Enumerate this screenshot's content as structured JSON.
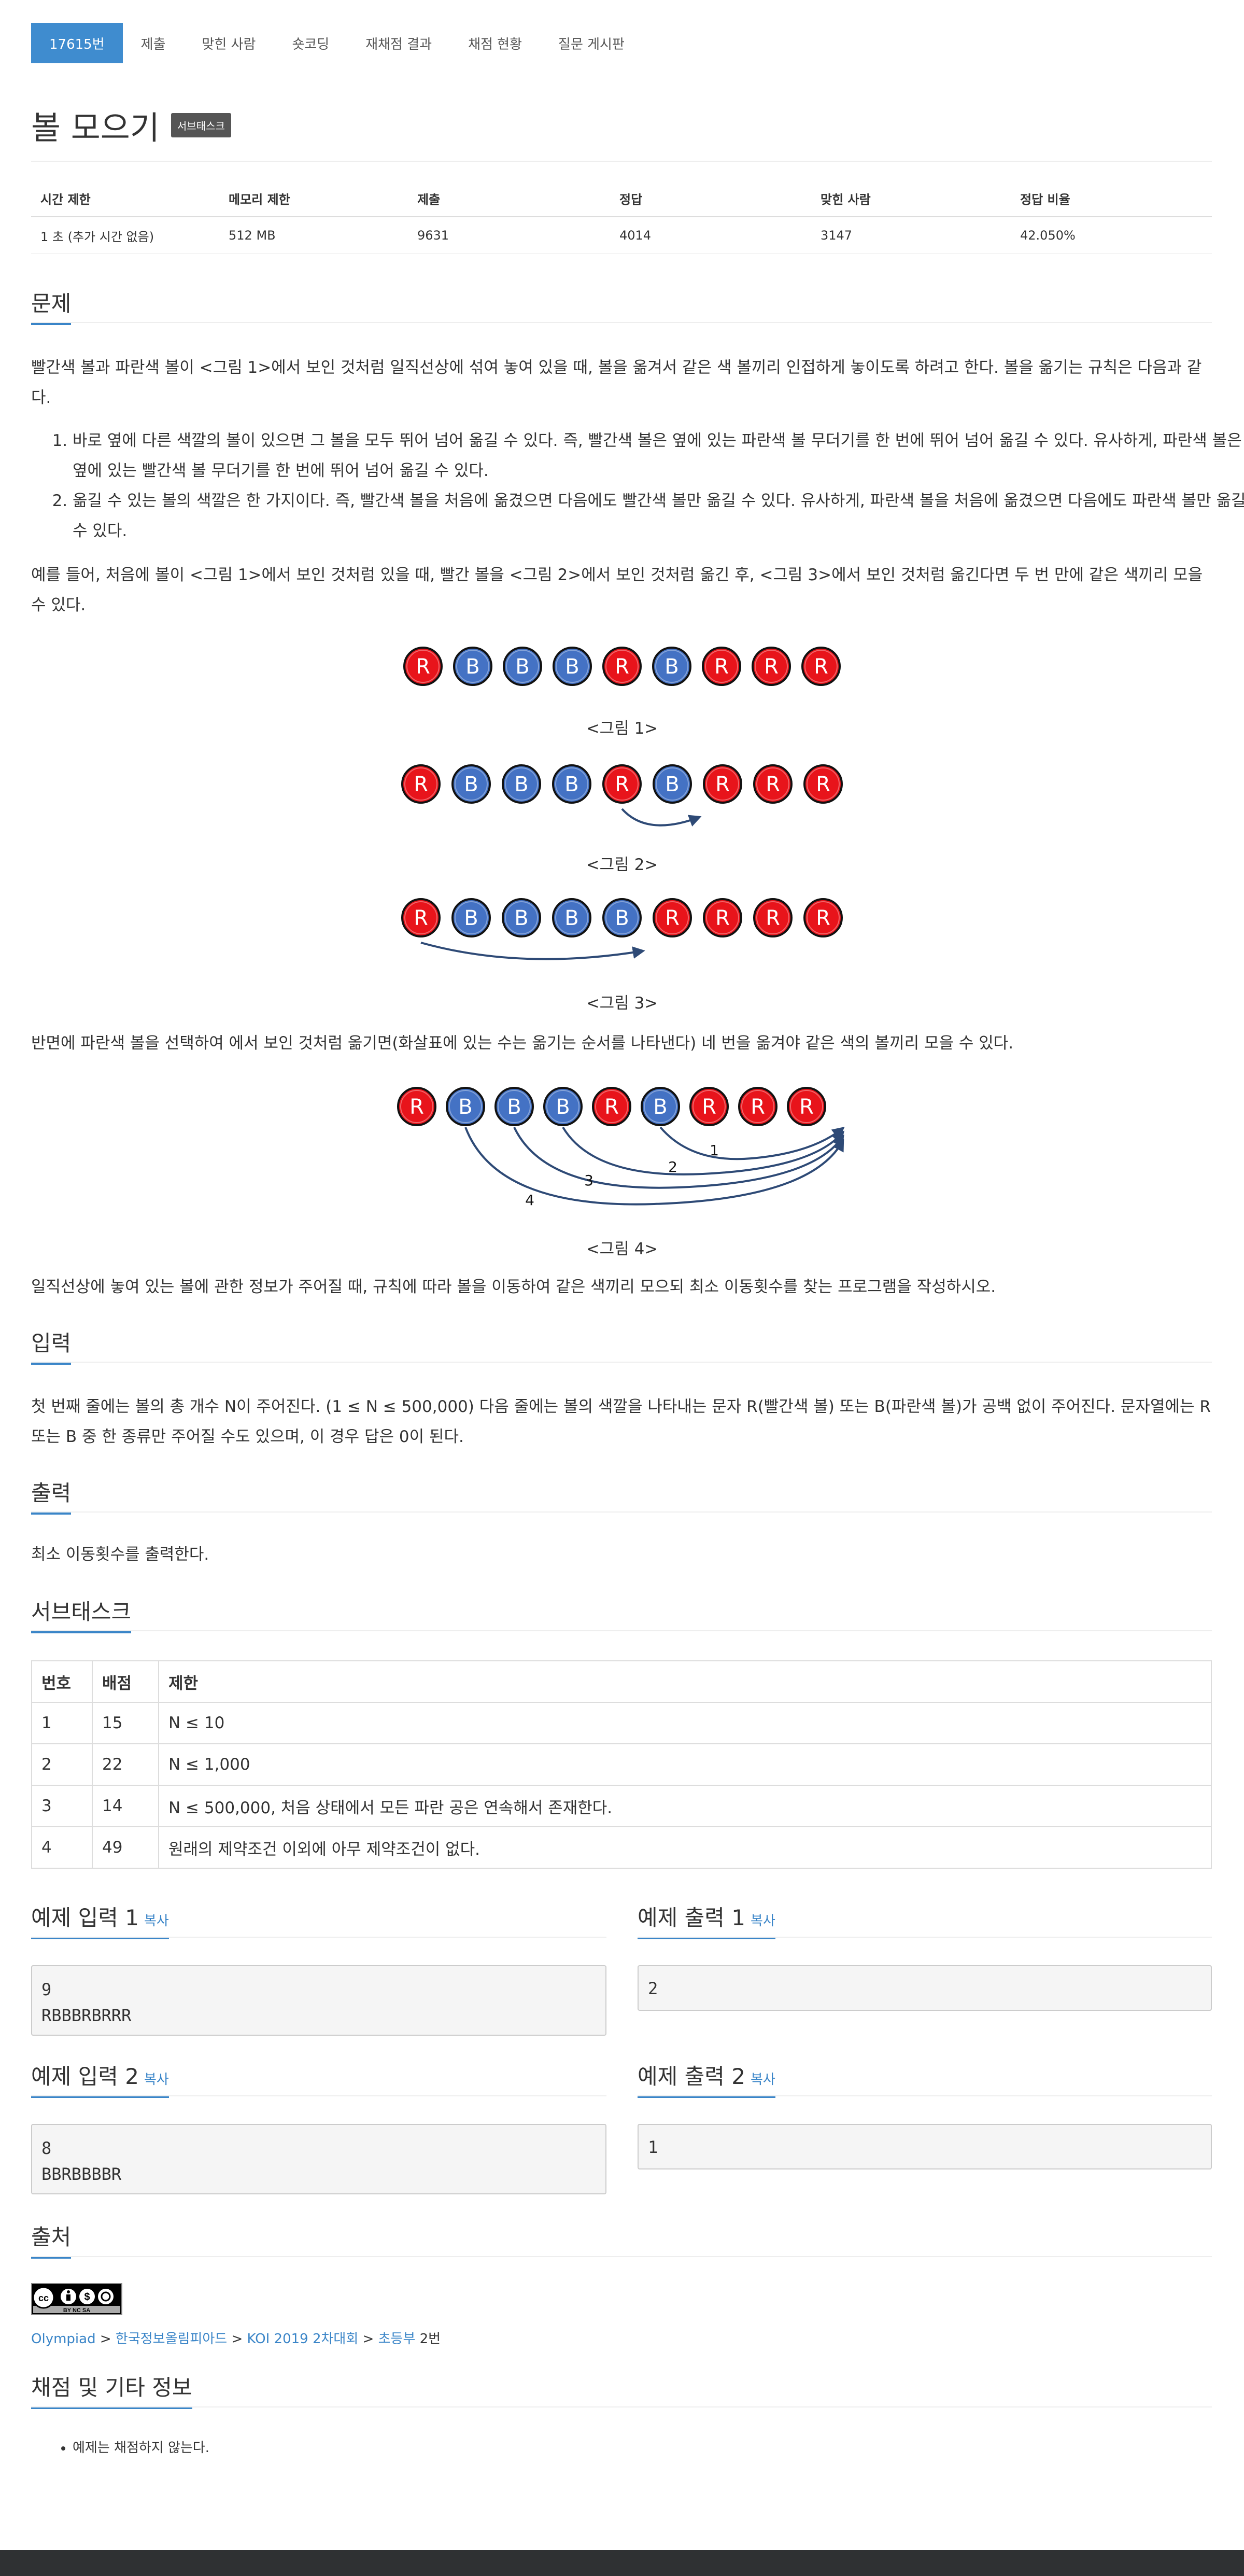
{
  "tabs": [
    {
      "label": "17615번",
      "active": true
    },
    {
      "label": "제출"
    },
    {
      "label": "맞힌 사람"
    },
    {
      "label": "숏코딩"
    },
    {
      "label": "재채점 결과"
    },
    {
      "label": "채점 현황"
    },
    {
      "label": "질문 게시판"
    }
  ],
  "problem": {
    "title": "볼 모으기",
    "badge": "서브태스크"
  },
  "info": {
    "headers": [
      "시간 제한",
      "메모리 제한",
      "제출",
      "정답",
      "맞힌 사람",
      "정답 비율"
    ],
    "values": [
      "1 초 (추가 시간 없음)",
      "512 MB",
      "9631",
      "4014",
      "3147",
      "42.050%"
    ]
  },
  "sections": {
    "problem": "문제",
    "input": "입력",
    "output": "출력",
    "subtask": "서브태스크",
    "sample_in_1": "예제 입력 1",
    "sample_out_1": "예제 출력 1",
    "sample_in_2": "예제 입력 2",
    "sample_out_2": "예제 출력 2",
    "source": "출처",
    "grading": "채점 및 기타 정보",
    "copy": "복사"
  },
  "body": {
    "p1": "빨간색 볼과 파란색 볼이 <그림 1>에서 보인 것처럼 일직선상에 섞여 놓여 있을 때, 볼을 옮겨서 같은 색 볼끼리 인접하게 놓이도록 하려고 한다. 볼을 옮기는 규칙은 다음과 같다.",
    "rule1": "바로 옆에 다른 색깔의 볼이 있으면 그 볼을 모두 뛰어 넘어 옮길 수 있다. 즉, 빨간색 볼은 옆에 있는 파란색 볼 무더기를 한 번에 뛰어 넘어 옮길 수 있다. 유사하게, 파란색 볼은 옆에 있는 빨간색 볼 무더기를 한 번에 뛰어 넘어 옮길 수 있다.",
    "rule2": "옮길 수 있는 볼의 색깔은 한 가지이다. 즉, 빨간색 볼을 처음에 옮겼으면 다음에도 빨간색 볼만 옮길 수 있다. 유사하게, 파란색 볼을 처음에 옮겼으면 다음에도 파란색 볼만 옮길 수 있다.",
    "p2": "예를 들어, 처음에 볼이 <그림 1>에서 보인 것처럼 있을 때, 빨간 볼을 <그림 2>에서 보인 것처럼 옮긴 후, <그림 3>에서 보인 것처럼 옮긴다면 두 번 만에 같은 색끼리 모을 수 있다.",
    "fig1": "<그림 1>",
    "fig2": "<그림 2>",
    "fig3": "<그림 3>",
    "fig4": "<그림 4>",
    "p3": "반면에 파란색 볼을 선택하여 에서 보인 것처럼 옮기면(화살표에 있는 수는 옮기는 순서를 나타낸다) 네 번을 옮겨야 같은 색의 볼끼리 모을 수 있다.",
    "p4": "일직선상에 놓여 있는 볼에 관한 정보가 주어질 때, 규칙에 따라 볼을 이동하여 같은 색끼리 모으되 최소 이동횟수를 찾는 프로그램을 작성하시오.",
    "input": "첫 번째 줄에는 볼의 총 개수 N이 주어진다. (1 ≤ N ≤ 500,000) 다음 줄에는 볼의 색깔을 나타내는 문자 R(빨간색 볼) 또는 B(파란색 볼)가 공백 없이 주어진다. 문자열에는 R 또는 B 중 한 종류만 주어질 수도 있으며, 이 경우 답은 0이 된다.",
    "output": "최소 이동횟수를 출력한다."
  },
  "figures": {
    "fig1_balls": [
      "R",
      "B",
      "B",
      "B",
      "R",
      "B",
      "R",
      "R",
      "R"
    ],
    "fig2_balls": [
      "R",
      "B",
      "B",
      "B",
      "R",
      "B",
      "R",
      "R",
      "R"
    ],
    "fig3_balls": [
      "R",
      "B",
      "B",
      "B",
      "B",
      "R",
      "R",
      "R",
      "R"
    ],
    "fig4_balls": [
      "R",
      "B",
      "B",
      "B",
      "R",
      "B",
      "R",
      "R",
      "R"
    ],
    "fig4_labels": [
      "1",
      "2",
      "3",
      "4"
    ],
    "colors": {
      "red": "#e8141b",
      "blue": "#4472c4",
      "arrow": "#2e4a76"
    }
  },
  "subtask_table": {
    "headers": [
      "번호",
      "배점",
      "제한"
    ],
    "rows": [
      [
        "1",
        "15",
        "N ≤ 10"
      ],
      [
        "2",
        "22",
        "N ≤ 1,000"
      ],
      [
        "3",
        "14",
        "N ≤ 500,000, 처음 상태에서 모든 파란 공은 연속해서 존재한다."
      ],
      [
        "4",
        "49",
        "원래의 제약조건 이외에 아무 제약조건이 없다."
      ]
    ]
  },
  "samples": {
    "in1": "9\nRBBBRBRRR",
    "out1": "2",
    "in2": "8\nBBRBBBBR",
    "out2": "1"
  },
  "source": {
    "crumbs": [
      "Olympiad",
      "한국정보올림피아드",
      "KOI 2019 2차대회",
      "초등부"
    ],
    "sep": " > ",
    "suffix": " 2번",
    "cc_text": "BY NC SA"
  },
  "grading": {
    "items": [
      "예제는 채점하지 않는다."
    ]
  },
  "accent": "#3a85c8"
}
